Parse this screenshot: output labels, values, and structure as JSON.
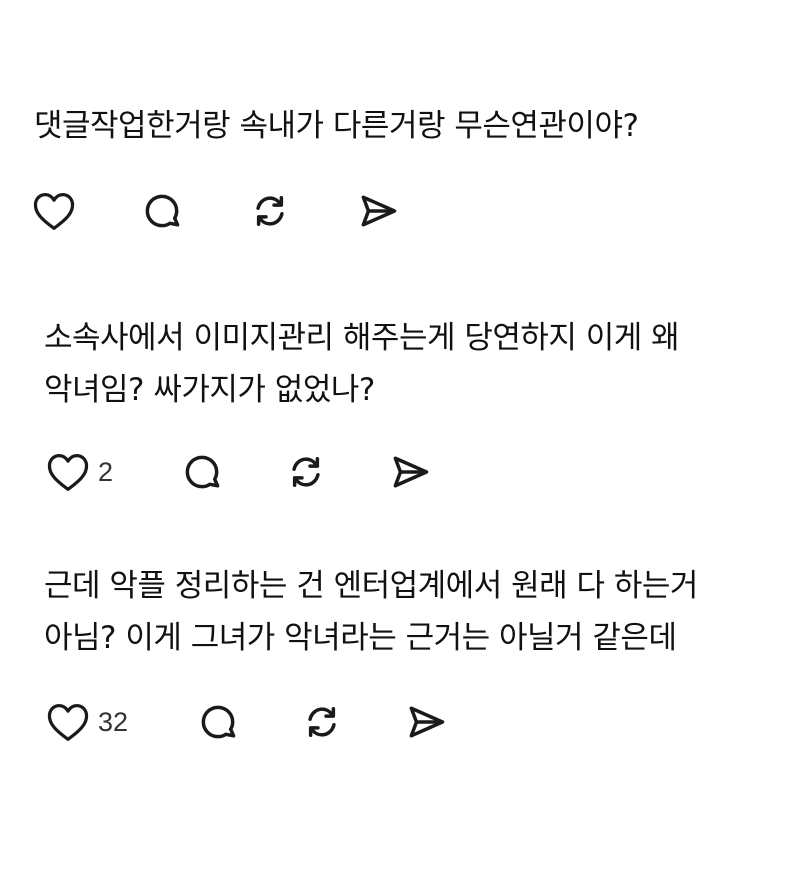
{
  "comments": [
    {
      "text": "댓글작업한거랑 속내가 다른거랑 무슨연관이야?",
      "like_count": ""
    },
    {
      "text": "소속사에서 이미지관리 해주는게 당연하지 이게 왜\n악녀임? 싸가지가 없었나?",
      "like_count": "2"
    },
    {
      "text": "근데 악플 정리하는 건 엔터업계에서 원래 다 하는거\n아님? 이게 그녀가 악녀라는 근거는 아닐거 같은데",
      "like_count": "32"
    }
  ],
  "icons": {
    "like": "heart-icon",
    "reply": "comment-bubble-icon",
    "repost": "repost-arrows-icon",
    "share": "send-paper-plane-icon"
  },
  "colors": {
    "text": "#111111",
    "icon": "#1a1a1a",
    "count": "#333333",
    "background": "#ffffff"
  }
}
